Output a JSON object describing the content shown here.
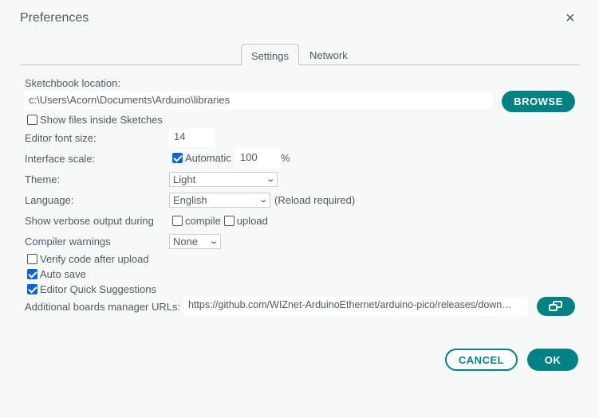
{
  "title": "Preferences",
  "close_icon": "×",
  "tabs": [
    "Settings",
    "Network"
  ],
  "sketchbook": {
    "label": "Sketchbook location:",
    "value": "c:\\Users\\Acorn\\Documents\\Arduino\\libraries",
    "browse": "BROWSE"
  },
  "show_files": {
    "label": "Show files inside Sketches",
    "checked": false
  },
  "font_size": {
    "label": "Editor font size:",
    "value": "14"
  },
  "scale": {
    "label": "Interface scale:",
    "auto_label": "Automatic",
    "auto_checked": true,
    "value": "100",
    "unit": "%"
  },
  "theme": {
    "label": "Theme:",
    "value": "Light"
  },
  "language": {
    "label": "Language:",
    "value": "English",
    "note": "(Reload required)"
  },
  "verbose": {
    "label": "Show verbose output during",
    "compile": "compile",
    "upload": "upload"
  },
  "warnings": {
    "label": "Compiler warnings",
    "value": "None"
  },
  "verify": {
    "label": "Verify code after upload",
    "checked": false
  },
  "autosave": {
    "label": "Auto save",
    "checked": true
  },
  "suggestions": {
    "label": "Editor Quick Suggestions",
    "checked": true
  },
  "boards": {
    "label": "Additional boards manager URLs:",
    "value": "https://github.com/WIZnet-ArduinoEthernet/arduino-pico/releases/down…"
  },
  "buttons": {
    "cancel": "CANCEL",
    "ok": "OK"
  },
  "colors": {
    "accent": "#008184",
    "bg": "#f7f9f9"
  }
}
